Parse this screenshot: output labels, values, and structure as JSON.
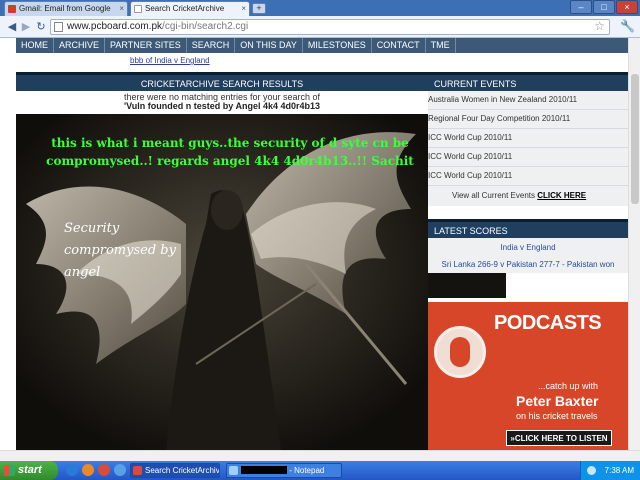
{
  "browser": {
    "tabs": [
      {
        "label": "Gmail: Email from Google",
        "active": false,
        "icon": "gmail-icon"
      },
      {
        "label": "Search CricketArchive",
        "active": true,
        "icon": "page-icon"
      }
    ],
    "new_tab_glyph": "+",
    "window_controls": {
      "minimize": "–",
      "maximize": "□",
      "close": "×"
    },
    "url_host": "www.pcboard.com.pk",
    "url_path": "/cgi-bin/search2.cgi",
    "back_glyph": "◀",
    "forward_glyph": "▶",
    "reload_glyph": "↻",
    "star_glyph": "☆",
    "wrench_glyph": "🔧"
  },
  "site": {
    "nav": [
      "HOME",
      "ARCHIVE",
      "PARTNER SITES",
      "SEARCH",
      "ON THIS DAY",
      "MILESTONES",
      "CONTACT",
      "TME"
    ],
    "breadcrumb": "bbb of India v England",
    "results_title": "CRICKETARCHIVE SEARCH RESULTS",
    "no_results": "there were no matching entries for your search of",
    "query": "'Vuln founded n tested by Angel 4k4 4d0r4b13",
    "defacement": {
      "green_message": "this is what i meant guys..the security of d syte cn be compromysed..! regards angel 4k4 4d0r4b13..!! Sachit",
      "white_message_lines": [
        "Security",
        "compromysed by",
        "angel"
      ]
    },
    "current_events": {
      "title": "CURRENT EVENTS",
      "items": [
        "Australia Women in New Zealand 2010/11",
        "Regional Four Day Competition 2010/11",
        "ICC World Cup 2010/11",
        "ICC World Cup 2010/11",
        "ICC World Cup 2010/11"
      ],
      "all_prefix": "View all Current Events",
      "all_link": "CLICK HERE"
    },
    "latest_scores": {
      "title": "LATEST SCORES",
      "items": [
        "India v England",
        "Sri Lanka 266-9 v Pakistan 277-7 - Pakistan won"
      ]
    },
    "podcast": {
      "title": "PODCASTS",
      "line1": "...catch up with",
      "name": "Peter Baxter",
      "line2": "on his cricket travels",
      "button": "»CLICK HERE TO LISTEN"
    }
  },
  "taskbar": {
    "start": "start",
    "buttons": [
      {
        "label": "Search CricketArchiv...",
        "active": true
      },
      {
        "label_suffix": " - Notepad",
        "active": false
      }
    ],
    "clock": "7:38 AM"
  },
  "colors": {
    "nav_bg": "#3c5a78",
    "header_bg": "#203e5e",
    "hacker_green": "#3cff3c",
    "podcast_orange": "#d8462a"
  }
}
